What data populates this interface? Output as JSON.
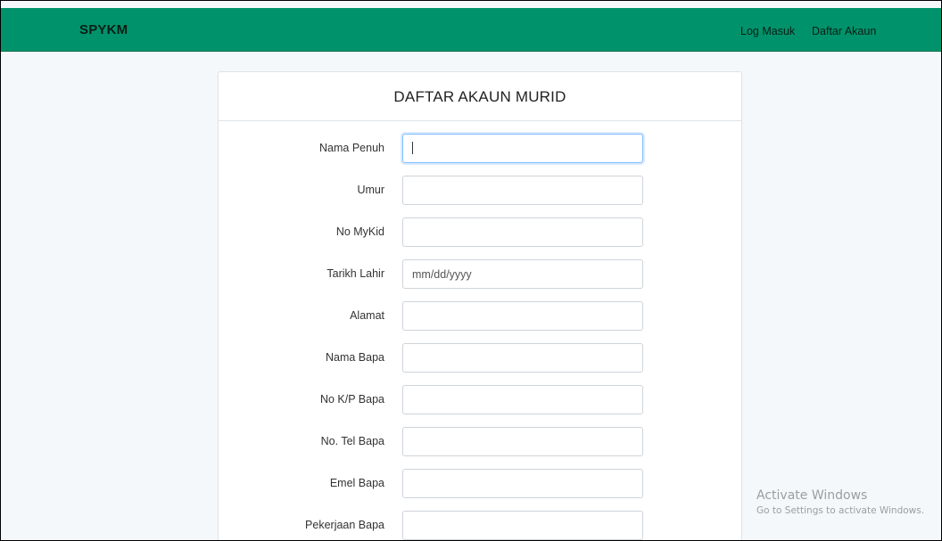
{
  "navbar": {
    "brand": "SPYKM",
    "links": [
      "Log Masuk",
      "Daftar Akaun"
    ],
    "color": "#00936b"
  },
  "form": {
    "title": "DAFTAR AKAUN MURID",
    "fields": [
      {
        "label": "Nama Penuh",
        "value": "",
        "placeholder": ""
      },
      {
        "label": "Umur",
        "value": "",
        "placeholder": ""
      },
      {
        "label": "No MyKid",
        "value": "",
        "placeholder": ""
      },
      {
        "label": "Tarikh Lahir",
        "value": "",
        "placeholder": "mm/dd/yyyy"
      },
      {
        "label": "Alamat",
        "value": "",
        "placeholder": ""
      },
      {
        "label": "Nama Bapa",
        "value": "",
        "placeholder": ""
      },
      {
        "label": "No K/P Bapa",
        "value": "",
        "placeholder": ""
      },
      {
        "label": "No. Tel Bapa",
        "value": "",
        "placeholder": ""
      },
      {
        "label": "Emel Bapa",
        "value": "",
        "placeholder": ""
      },
      {
        "label": "Pekerjaan Bapa",
        "value": "",
        "placeholder": ""
      }
    ]
  },
  "watermark": {
    "title": "Activate Windows",
    "subtitle": "Go to Settings to activate Windows."
  }
}
